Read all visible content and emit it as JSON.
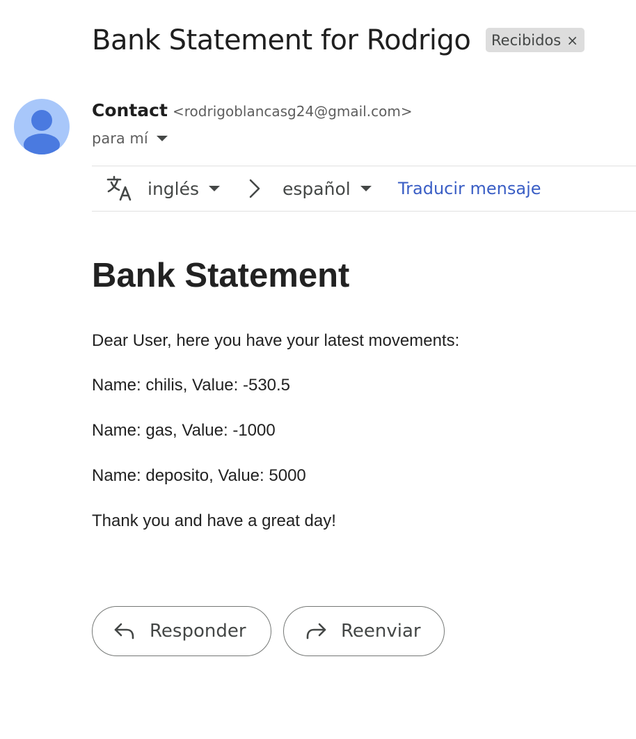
{
  "email": {
    "subject": "Bank Statement for Rodrigo",
    "label": "Recibidos",
    "label_close": "×",
    "sender_name": "Contact",
    "sender_email": "<rodrigoblancasg24@gmail.com>",
    "recipient": "para mí"
  },
  "translate_bar": {
    "source_language": "inglés",
    "target_language": "español",
    "translate_link": "Traducir mensaje"
  },
  "message": {
    "title": "Bank Statement",
    "greeting": "Dear User, here you have your latest movements:",
    "movements": [
      "Name: chilis, Value: -530.5",
      "Name: gas, Value: -1000",
      "Name: deposito, Value: 5000"
    ],
    "closing": "Thank you and have a great day!"
  },
  "actions": {
    "reply_label": "Responder",
    "forward_label": "Reenviar"
  },
  "icons": {
    "avatar": "person-avatar-icon",
    "translate": "translate-icon",
    "arrow": "chevron-right-icon",
    "reply": "reply-icon",
    "forward": "forward-icon"
  },
  "colors": {
    "avatar_bg": "#a8c7fa",
    "avatar_fg": "#4a7ae0",
    "link": "#3a5ec5",
    "chip_bg": "#dddddd"
  }
}
